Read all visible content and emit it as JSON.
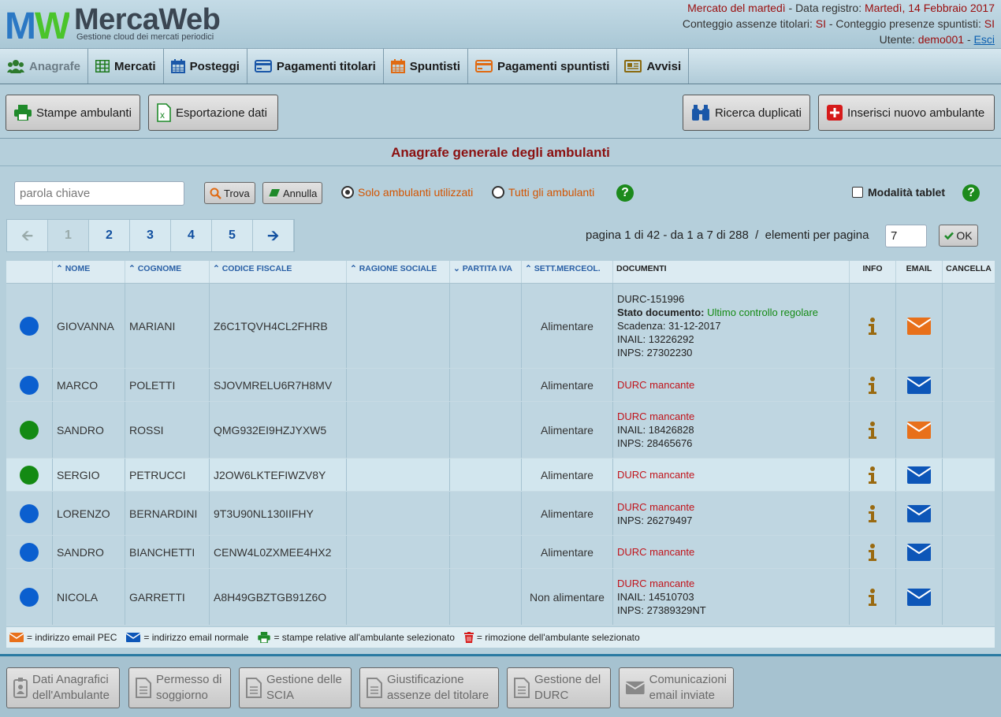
{
  "brand": {
    "name": "MercaWeb",
    "subtitle": "Gestione cloud dei mercati periodici",
    "mark_letters": "MW"
  },
  "header": {
    "market": "Mercato del martedì",
    "reg_label": " - Data registro: ",
    "reg_date": "Martedì, 14 Febbraio 2017",
    "absences_label": "Conteggio assenze titolari: ",
    "absences_value": "SI",
    "presences_label": " - Conteggio presenze spuntisti: ",
    "presences_value": "SI",
    "user_label": "Utente: ",
    "user_value": "demo001",
    "sep": " - ",
    "logout": "Esci"
  },
  "nav": [
    {
      "label": "Anagrafe",
      "icon": "users-icon"
    },
    {
      "label": "Mercati",
      "icon": "grid-icon"
    },
    {
      "label": "Posteggi",
      "icon": "calendar-icon"
    },
    {
      "label": "Pagamenti titolari",
      "icon": "credit-card-icon"
    },
    {
      "label": "Spuntisti",
      "icon": "calendar-icon"
    },
    {
      "label": "Pagamenti spuntisti",
      "icon": "credit-card-icon"
    },
    {
      "label": "Avvisi",
      "icon": "newspaper-icon"
    }
  ],
  "toolbar": {
    "print": "Stampe ambulanti",
    "export": "Esportazione dati",
    "duplicates": "Ricerca duplicati",
    "insert": "Inserisci nuovo ambulante"
  },
  "page_title": "Anagrafe generale degli ambulanti",
  "search": {
    "placeholder": "parola chiave",
    "find": "Trova",
    "cancel": "Annulla",
    "radio_used": "Solo ambulanti utilizzati",
    "radio_all": "Tutti gli ambulanti",
    "help": "?",
    "tablet_mode": "Modalità tablet"
  },
  "pager": {
    "pages": [
      "1",
      "2",
      "3",
      "4",
      "5"
    ],
    "info": "pagina 1 di 42 - da 1 a 7 di 288  /  elementi per pagina",
    "per_page": "7",
    "ok": "OK"
  },
  "columns": [
    "NOME",
    "COGNOME",
    "CODICE FISCALE",
    "RAGIONE SOCIALE",
    "PARTITA IVA",
    "SETT.MERCEOL.",
    "DOCUMENTI",
    "INFO",
    "EMAIL",
    "CANCELLA"
  ],
  "rows": [
    {
      "status": "#0b5fcf",
      "nome": "GIOVANNA",
      "cognome": "MARIANI",
      "cf": "Z6C1TQVH4CL2FHRB",
      "sett": "Alimentare",
      "email": "pec",
      "doc": [
        {
          "t": "DURC-151996",
          "c": ""
        },
        {
          "t": "Stato documento: ",
          "c": "bold",
          "extra": "Ultimo controllo regolare"
        },
        {
          "t": "Scadenza: 31-12-2017",
          "c": ""
        },
        {
          "t": "INAIL: 13226292",
          "c": ""
        },
        {
          "t": "INPS: 27302230",
          "c": ""
        }
      ]
    },
    {
      "status": "#0b5fcf",
      "nome": "MARCO",
      "cognome": "POLETTI",
      "cf": "SJOVMRELU6R7H8MV",
      "sett": "Alimentare",
      "email": "normal",
      "doc": [
        {
          "t": "DURC mancante",
          "c": "red"
        }
      ]
    },
    {
      "status": "#138a13",
      "nome": "SANDRO",
      "cognome": "ROSSI",
      "cf": "QMG932EI9HZJYXW5",
      "sett": "Alimentare",
      "email": "pec",
      "doc": [
        {
          "t": "DURC mancante",
          "c": "red"
        },
        {
          "t": "INAIL: 18426828",
          "c": ""
        },
        {
          "t": "INPS: 28465676",
          "c": ""
        }
      ]
    },
    {
      "status": "#138a13",
      "nome": "SERGIO",
      "cognome": "PETRUCCI",
      "cf": "J2OW6LKTEFIWZV8Y",
      "sett": "Alimentare",
      "email": "normal",
      "doc": [
        {
          "t": "DURC mancante",
          "c": "red"
        }
      ]
    },
    {
      "status": "#0b5fcf",
      "nome": "LORENZO",
      "cognome": "BERNARDINI",
      "cf": "9T3U90NL130IIFHY",
      "sett": "Alimentare",
      "email": "normal",
      "doc": [
        {
          "t": "DURC mancante",
          "c": "red"
        },
        {
          "t": "INPS: 26279497",
          "c": ""
        }
      ]
    },
    {
      "status": "#0b5fcf",
      "nome": "SANDRO",
      "cognome": "BIANCHETTI",
      "cf": "CENW4L0ZXMEE4HX2",
      "sett": "Alimentare",
      "email": "normal",
      "doc": [
        {
          "t": "DURC mancante",
          "c": "red"
        }
      ]
    },
    {
      "status": "#0b5fcf",
      "nome": "NICOLA",
      "cognome": "GARRETTI",
      "cf": "A8H49GBZTGB91Z6O",
      "sett": "Non alimentare",
      "email": "normal",
      "doc": [
        {
          "t": "DURC mancante",
          "c": "red"
        },
        {
          "t": "INAIL: 14510703",
          "c": ""
        },
        {
          "t": "INPS: 27389329NT",
          "c": ""
        }
      ]
    }
  ],
  "legend": {
    "pec": "= indirizzo email PEC",
    "normal": "= indirizzo email normale",
    "print": "= stampe relative all'ambulante selezionato",
    "delete": "= rimozione dell'ambulante selezionato"
  },
  "footer": [
    {
      "label": "Dati Anagrafici\ndell'Ambulante",
      "icon": "id-badge-icon"
    },
    {
      "label": "Permesso di\nsoggiorno",
      "icon": "document-icon"
    },
    {
      "label": "Gestione delle\nSCIA",
      "icon": "document-icon"
    },
    {
      "label": "Giustificazione\nassenze del titolare",
      "icon": "document-icon"
    },
    {
      "label": "Gestione del\nDURC",
      "icon": "document-icon"
    },
    {
      "label": "Comunicazioni\nemail inviate",
      "icon": "envelope-icon"
    }
  ],
  "colors": {
    "brand_red": "#9a0d0d",
    "pec_orange": "#e8701a",
    "mail_blue": "#0d56b8",
    "info_brown": "#9a6a10",
    "help_green": "#1c8a1c"
  }
}
